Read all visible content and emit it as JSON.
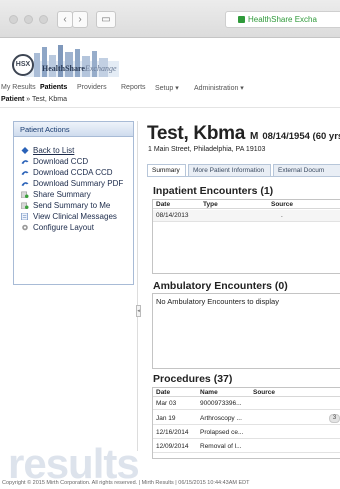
{
  "browser": {
    "url_text": "HealthShare Excha",
    "back_glyph": "‹",
    "forward_glyph": "›",
    "sidebar_glyph": "▭"
  },
  "logo": {
    "badge": "HSX",
    "name_part1": "HealthShare",
    "name_part2": "Exchange"
  },
  "topnav": {
    "items": [
      "My Results",
      "Patients",
      "Providers",
      "Reports",
      "Setup ▾",
      "Administration ▾"
    ],
    "active": "Patients"
  },
  "breadcrumb": {
    "root": "Patient",
    "sep": " » ",
    "current": "Test, Kbma"
  },
  "actions": {
    "title": "Patient Actions",
    "items": [
      {
        "label": "Back to List",
        "icon": "diamond-icon"
      },
      {
        "label": "Download CCD",
        "icon": "download-icon"
      },
      {
        "label": "Download CCDA CCD",
        "icon": "download-icon"
      },
      {
        "label": "Download Summary PDF",
        "icon": "download-icon"
      },
      {
        "label": "Share Summary",
        "icon": "share-icon"
      },
      {
        "label": "Send Summary to Me",
        "icon": "send-icon"
      },
      {
        "label": "View Clinical Messages",
        "icon": "messages-icon"
      },
      {
        "label": "Configure Layout",
        "icon": "gear-icon"
      }
    ]
  },
  "patient": {
    "name": "Test, Kbma",
    "sex": "M",
    "dob_age": "08/14/1954 (60 yrs",
    "address": "1 Main Street, Philadelphia, PA 19103"
  },
  "tabs": [
    "Summary",
    "More Patient Information",
    "External Docum"
  ],
  "inpatient": {
    "title": "Inpatient Encounters (1)",
    "columns": [
      "Date",
      "Type",
      "Source"
    ],
    "rows": [
      [
        "08/14/2013",
        "",
        "."
      ]
    ]
  },
  "ambulatory": {
    "title": "Ambulatory Encounters (0)",
    "empty_message": "No Ambulatory Encounters to display"
  },
  "procedures": {
    "title": "Procedures (37)",
    "columns": [
      "Date",
      "Name",
      "Source"
    ],
    "rows": [
      {
        "date": "Mar 03",
        "name": "9000973396...",
        "source": "",
        "badge": ""
      },
      {
        "date": "Jan 19",
        "name": "Arthroscopy ...",
        "source": "",
        "badge": "3"
      },
      {
        "date": "12/16/2014",
        "name": "Prolapsed ce...",
        "source": "",
        "badge": ""
      },
      {
        "date": "12/09/2014",
        "name": "Removal of l...",
        "source": "",
        "badge": ""
      }
    ]
  },
  "watermark": "results",
  "footer": "Copyright © 2015 Mirth Corporation. All rights reserved. | Mirth Results | 06/15/2015 10:44:43AM EDT",
  "colors": {
    "brand_navy": "#1a3c70",
    "secure_green": "#2f9a3a",
    "panel_border": "#a8bbd6"
  }
}
